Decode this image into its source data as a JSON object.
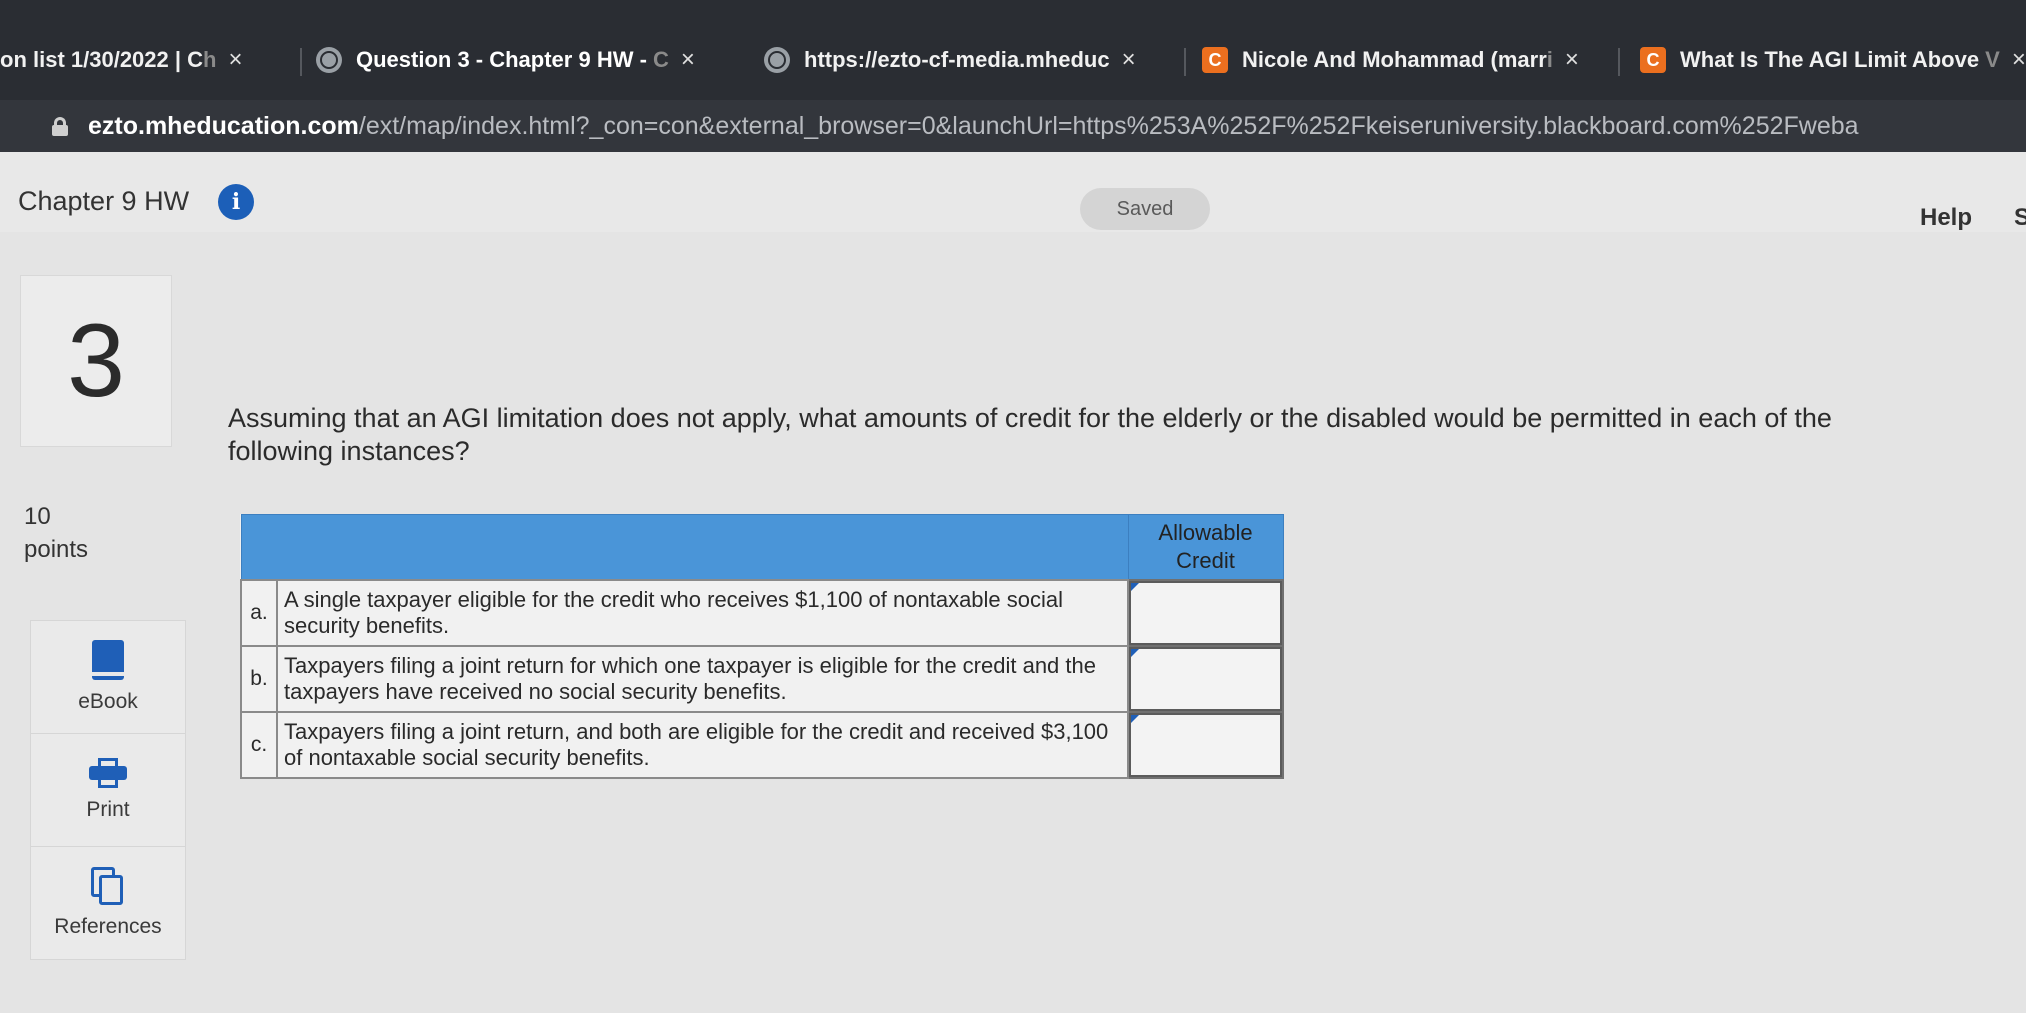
{
  "browser": {
    "tabs": [
      {
        "title": "on list 1/30/2022 | C",
        "faded": "h",
        "close": "×",
        "icon": "none"
      },
      {
        "title": "Question 3 - Chapter 9 HW - ",
        "faded": "C",
        "close": "×",
        "icon": "globe-icon"
      },
      {
        "title": "https://ezto-cf-media.mheduc",
        "faded": "",
        "close": "×",
        "icon": "globe-icon"
      },
      {
        "title": "Nicole And Mohammad (marr",
        "faded": "i",
        "close": "×",
        "icon": "chegg-icon"
      },
      {
        "title": "What Is The AGI Limit Above ",
        "faded": "V",
        "close": "×",
        "icon": "chegg-icon"
      }
    ],
    "chegg_icon_letter": "C",
    "url_host": "ezto.mheducation.com",
    "url_path": "/ext/map/index.html?_con=con&external_browser=0&launchUrl=https%253A%252F%252Fkeiseruniversity.blackboard.com%252Fweba"
  },
  "header": {
    "assignment_title": "Chapter 9 HW",
    "info_icon_glyph": "i",
    "saved_label": "Saved",
    "help_label": "Help",
    "help_extra": "S"
  },
  "question": {
    "number": "3",
    "points_value": "10",
    "points_label": "points",
    "text": "Assuming that an AGI limitation does not apply, what amounts of credit for the elderly or the disabled would be permitted in each of the following instances?"
  },
  "tools": {
    "ebook_label": "eBook",
    "print_label": "Print",
    "references_label": "References"
  },
  "table": {
    "column_header": "Allowable Credit",
    "rows": [
      {
        "letter": "a.",
        "description": "A single taxpayer eligible for the credit who receives $1,100 of nontaxable social security benefits.",
        "value": ""
      },
      {
        "letter": "b.",
        "description": "Taxpayers filing a joint return for which one taxpayer is eligible for the credit and the taxpayers have received no social security benefits.",
        "value": ""
      },
      {
        "letter": "c.",
        "description": "Taxpayers filing a joint return, and both are eligible for the credit and received $3,100 of nontaxable social security benefits.",
        "value": ""
      }
    ]
  },
  "colors": {
    "table_header": "#4a95d8",
    "info_icon": "#1c5fb8",
    "tool_icon": "#1f5fb7",
    "chegg_orange": "#eb6f1f"
  }
}
